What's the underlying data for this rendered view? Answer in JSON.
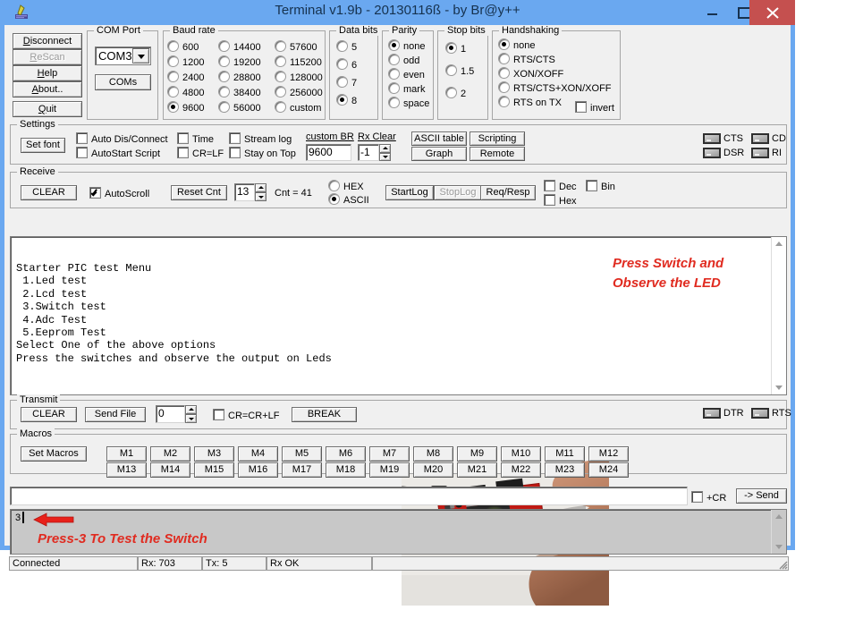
{
  "window": {
    "title": "Terminal v1.9b - 20130116ß - by Br@y++",
    "icon": "terminal-app-icon",
    "minimize": "minimize-icon",
    "maximize": "maximize-icon",
    "close": "close-icon"
  },
  "left_buttons": [
    {
      "label": "Disconnect",
      "accel": "D",
      "disabled": false
    },
    {
      "label": "ReScan",
      "accel": "R",
      "disabled": true
    },
    {
      "label": "Help",
      "accel": "H",
      "disabled": false
    },
    {
      "label": "About..",
      "accel": "A",
      "disabled": false
    },
    {
      "label": "Quit",
      "accel": "Q",
      "disabled": false
    }
  ],
  "com_port": {
    "caption": "COM Port",
    "selected": "COM3",
    "coms_button": "COMs"
  },
  "baud_rate": {
    "caption": "Baud rate",
    "selected": "9600",
    "col1": [
      "600",
      "1200",
      "2400",
      "4800",
      "9600"
    ],
    "col2": [
      "14400",
      "19200",
      "28800",
      "38400",
      "56000"
    ],
    "col3": [
      "57600",
      "115200",
      "128000",
      "256000",
      "custom"
    ]
  },
  "data_bits": {
    "caption": "Data bits",
    "selected": "8",
    "options": [
      "5",
      "6",
      "7",
      "8"
    ]
  },
  "parity": {
    "caption": "Parity",
    "selected": "none",
    "options": [
      "none",
      "odd",
      "even",
      "mark",
      "space"
    ]
  },
  "stop_bits": {
    "caption": "Stop bits",
    "selected": "1",
    "options": [
      "1",
      "1.5",
      "2"
    ]
  },
  "handshaking": {
    "caption": "Handshaking",
    "selected": "none",
    "options": [
      "none",
      "RTS/CTS",
      "XON/XOFF",
      "RTS/CTS+XON/XOFF",
      "RTS on TX"
    ],
    "invert_label": "invert",
    "invert_checked": false
  },
  "settings": {
    "caption": "Settings",
    "set_font": "Set font",
    "checks": [
      {
        "label": "Auto Dis/Connect",
        "checked": false
      },
      {
        "label": "AutoStart Script",
        "checked": false
      },
      {
        "label": "Time",
        "checked": false
      },
      {
        "label": "CR=LF",
        "checked": false
      },
      {
        "label": "Stream log",
        "checked": false
      },
      {
        "label": "Stay on Top",
        "checked": false
      }
    ],
    "custom_br_label": "custom BR",
    "custom_br_value": "9600",
    "rx_clear_label": "Rx Clear",
    "rx_clear_value": "-1",
    "ascii_table": "ASCII table",
    "scripting": "Scripting",
    "graph": "Graph",
    "remote": "Remote",
    "indicators": [
      {
        "label": "CTS",
        "on": false
      },
      {
        "label": "CD",
        "on": false
      },
      {
        "label": "DSR",
        "on": false
      },
      {
        "label": "RI",
        "on": false
      }
    ]
  },
  "receive": {
    "caption": "Receive",
    "clear": "CLEAR",
    "autoscroll_label": "AutoScroll",
    "autoscroll_checked": true,
    "reset_cnt": "Reset Cnt",
    "cnt_field": "13",
    "cnt_label": "Cnt = 41",
    "mode_selected": "ASCII",
    "modes": [
      "HEX",
      "ASCII"
    ],
    "start_log": "StartLog",
    "stop_log": "StopLog",
    "req_resp": "Req/Resp",
    "dec_label": "Dec",
    "dec_checked": false,
    "hex_label": "Hex",
    "hex_checked": false,
    "bin_label": "Bin",
    "bin_checked": false
  },
  "terminal": {
    "text": "Starter PIC test Menu\n 1.Led test\n 2.Lcd test\n 3.Switch test\n 4.Adc Test\n 5.Eeprom Test\nSelect One of the above options\nPress the switches and observe the output on Leds",
    "annotation_line1": "Press Switch and",
    "annotation_line2": "Observe the LED",
    "photo_alt": "pic-development-board-photo",
    "scroll_up": "scroll-up-arrow",
    "scroll_down": "scroll-down-arrow"
  },
  "transmit": {
    "caption": "Transmit",
    "clear": "CLEAR",
    "send_file": "Send File",
    "delay_value": "0",
    "crcrlf_label": "CR=CR+LF",
    "crcrlf_checked": false,
    "break": "BREAK",
    "indicators": [
      {
        "label": "DTR",
        "on": false
      },
      {
        "label": "RTS",
        "on": false
      }
    ]
  },
  "macros": {
    "caption": "Macros",
    "set_macros": "Set Macros",
    "row1": [
      "M1",
      "M2",
      "M3",
      "M4",
      "M5",
      "M6",
      "M7",
      "M8",
      "M9",
      "M10",
      "M11",
      "M12"
    ],
    "row2": [
      "M13",
      "M14",
      "M15",
      "M16",
      "M17",
      "M18",
      "M19",
      "M20",
      "M21",
      "M22",
      "M23",
      "M24"
    ]
  },
  "send_row": {
    "input_value": "",
    "cr_label": "+CR",
    "cr_checked": false,
    "send_button": "-> Send"
  },
  "tx_area": {
    "typed": "3",
    "annotation": "Press-3 To Test the Switch",
    "arrow": "red-left-arrow"
  },
  "status_bar": {
    "connection": "Connected",
    "rx": "Rx: 703",
    "tx": "Tx: 5",
    "rx_state": "Rx OK",
    "extra": ""
  },
  "colors": {
    "title_bar": "#6aa8f0",
    "close_button": "#c5504f",
    "annotation_red": "#e02b20",
    "dialog_face": "#f0f0f0",
    "tx_area": "#c8c8c8"
  }
}
